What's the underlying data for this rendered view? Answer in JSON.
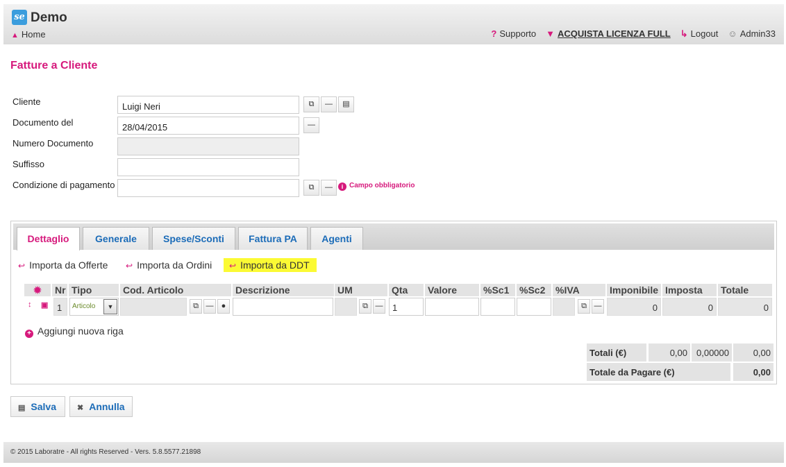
{
  "header": {
    "logo_text": "se",
    "app_title": "Demo",
    "home_label": "Home",
    "nav": {
      "support": "Supporto",
      "license": "ACQUISTA LICENZA FULL",
      "logout": "Logout",
      "user": "Admin33"
    }
  },
  "page_title": "Fatture a Cliente",
  "form": {
    "cliente_label": "Cliente",
    "cliente_value": "Luigi Neri",
    "documento_label": "Documento del",
    "documento_value": "28/04/2015",
    "numero_label": "Numero Documento",
    "numero_value": "",
    "suffisso_label": "Suffisso",
    "suffisso_value": "",
    "condizione_label": "Condizione di pagamento",
    "condizione_value": "",
    "required_msg": "Campo obbligatorio"
  },
  "tabs": [
    "Dettaglio",
    "Generale",
    "Spese/Sconti",
    "Fattura PA",
    "Agenti"
  ],
  "import_links": [
    "Importa da Offerte",
    "Importa da Ordini",
    "Importa da DDT"
  ],
  "table": {
    "headers": {
      "nr": "Nr",
      "tipo": "Tipo",
      "cod": "Cod. Articolo",
      "descr": "Descrizione",
      "um": "UM",
      "qta": "Qta",
      "valore": "Valore",
      "sc1": "%Sc1",
      "sc2": "%Sc2",
      "iva": "%IVA",
      "imponibile": "Imponibile",
      "imposta": "Imposta",
      "totale": "Totale"
    },
    "row": {
      "nr": "1",
      "tipo": "Articolo",
      "cod": "",
      "descr": "",
      "um": "",
      "qta": "1",
      "valore": "",
      "sc1": "",
      "sc2": "",
      "iva": "",
      "imponibile": "0",
      "imposta": "0",
      "totale": "0"
    }
  },
  "add_row_label": "Aggiungi nuova riga",
  "totals": {
    "totali_label": "Totali (€)",
    "imponibile": "0,00",
    "imposta": "0,00000",
    "totale": "0,00",
    "pagare_label": "Totale da Pagare (€)",
    "pagare_value": "0,00"
  },
  "actions": {
    "save": "Salva",
    "cancel": "Annulla"
  },
  "footer": "© 2015 Laboratre - All rights Reserved - Vers. 5.8.5577.21898",
  "colors": {
    "accent": "#d6197c",
    "link": "#1c6cb8",
    "highlight": "#fbfa34"
  }
}
